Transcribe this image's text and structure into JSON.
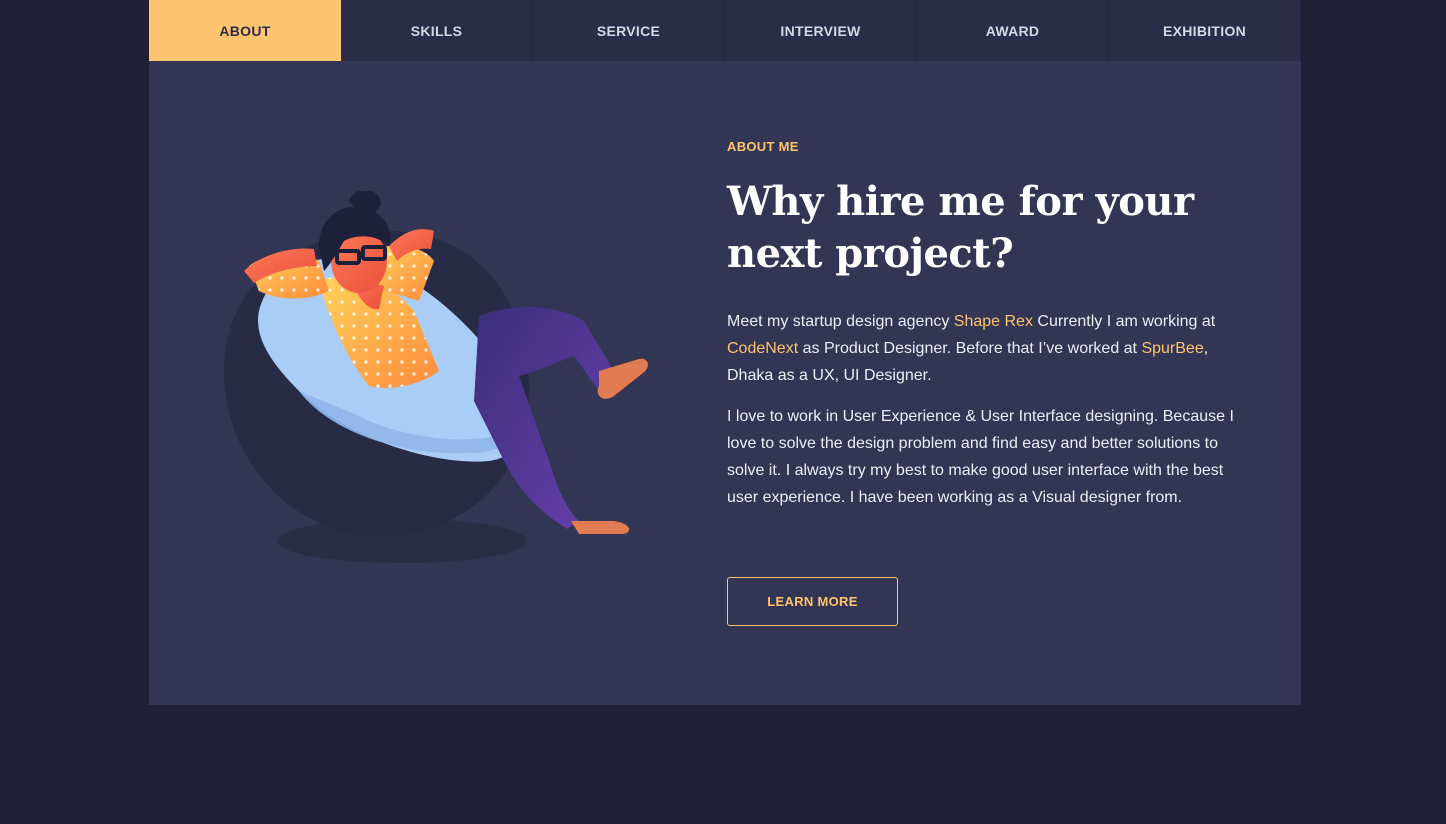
{
  "nav": {
    "tabs": [
      "ABOUT",
      "SKILLS",
      "SERVICE",
      "INTERVIEW",
      "AWARD",
      "EXHIBITION"
    ],
    "active": "ABOUT"
  },
  "about": {
    "eyebrow": "ABOUT ME",
    "title": "Why hire me for your next project?",
    "p1": {
      "t1": "Meet my startup design agency ",
      "l1": "Shape Rex",
      "t2": " Currently I am working at ",
      "l2": "CodeNext",
      "t3": " as Product Designer. Before that I’ve worked at ",
      "l3": "SpurBee",
      "t4": ", Dhaka as a UX, UI Designer."
    },
    "p2": "I love to work in User Experience & User Interface designing. Because I love to solve the design problem and find easy and better solutions to solve it. I always try my best to make good user interface with the best user experience. I have been working as a Visual designer from.",
    "button": "LEARN MORE"
  },
  "colors": {
    "background": "#1f2035",
    "panel": "#323553",
    "accent": "#ffc46f"
  },
  "illustration": "man-relaxing-in-bean-bag-chair"
}
